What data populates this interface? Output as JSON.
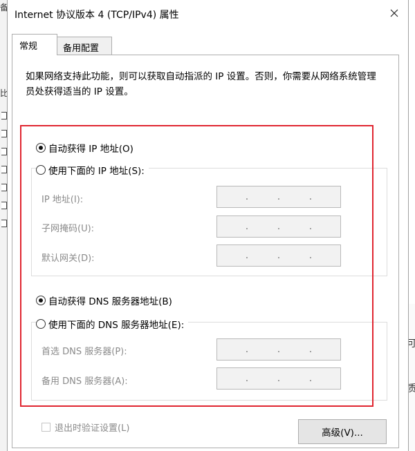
{
  "window": {
    "title": "Internet 协议版本 4 (TCP/IPv4) 属性"
  },
  "tabs": [
    {
      "label": "常规",
      "active": true
    },
    {
      "label": "备用配置",
      "active": false
    }
  ],
  "intro_text": "如果网络支持此功能，则可以获取自动指派的 IP 设置。否则，你需要从网络系统管理员处获得适当的 IP 设置。",
  "ip_section": {
    "auto_label": "自动获得 IP 地址(O)",
    "auto_selected": true,
    "manual_label": "使用下面的 IP 地址(S):",
    "manual_selected": false,
    "fields": [
      {
        "label": "IP 地址(I):",
        "value": ".   .   ."
      },
      {
        "label": "子网掩码(U):",
        "value": ".   .   ."
      },
      {
        "label": "默认网关(D):",
        "value": ".   .   ."
      }
    ]
  },
  "dns_section": {
    "auto_label": "自动获得 DNS 服务器地址(B)",
    "auto_selected": true,
    "manual_label": "使用下面的 DNS 服务器地址(E):",
    "manual_selected": false,
    "fields": [
      {
        "label": "首选 DNS 服务器(P):",
        "value": ".   .   ."
      },
      {
        "label": "备用 DNS 服务器(A):",
        "value": ".   .   ."
      }
    ]
  },
  "validate_label": "退出时验证设置(L)",
  "advanced_label": "高级(V)...",
  "background": {
    "left_fragments": [
      "备",
      "比"
    ],
    "right_fragments": [
      "可",
      "质"
    ]
  },
  "colors": {
    "highlight_border": "#e0242f",
    "disabled_text": "#8a8a8a"
  }
}
